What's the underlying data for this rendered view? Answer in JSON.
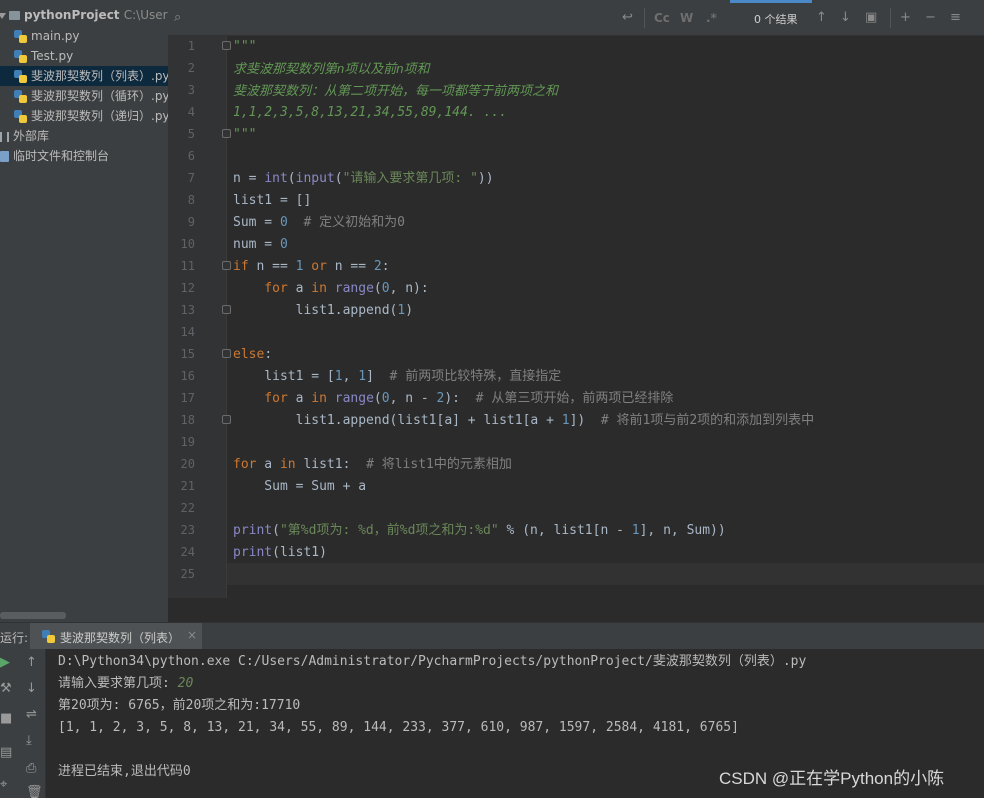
{
  "project_tree": {
    "root_name": "pythonProject",
    "root_path": "C:\\Users\\A",
    "items": [
      {
        "label": "main.py",
        "selected": false
      },
      {
        "label": "Test.py",
        "selected": false
      },
      {
        "label": "斐波那契数列（列表）.py",
        "selected": true
      },
      {
        "label": "斐波那契数列（循环）.py",
        "selected": false
      },
      {
        "label": "斐波那契数列（递归）.py",
        "selected": false
      }
    ],
    "external_libs": "外部库",
    "scratches": "临时文件和控制台"
  },
  "search": {
    "icon": "search-icon",
    "results_text": "0 个结果",
    "match_case_label": "Cc",
    "words_label": "W",
    "regex_label": ".*"
  },
  "editor": {
    "line_numbers": [
      "1",
      "2",
      "3",
      "4",
      "5",
      "6",
      "7",
      "8",
      "9",
      "10",
      "11",
      "12",
      "13",
      "14",
      "15",
      "16",
      "17",
      "18",
      "19",
      "20",
      "21",
      "22",
      "23",
      "24",
      "25"
    ],
    "current_line": "25",
    "code": {
      "l1": "\"\"\"",
      "l2": "求斐波那契数列第n项以及前n项和",
      "l3": "斐波那契数列：从第二项开始，每一项都等于前两项之和",
      "l4": "1,1,2,3,5,8,13,21,34,55,89,144. ...",
      "l5": "\"\"\"",
      "l7_a": "n = ",
      "l7_b": "int",
      "l7_c": "(",
      "l7_d": "input",
      "l7_e": "(",
      "l7_f": "\"请输入要求第几项: \"",
      "l7_g": "))",
      "l8": "list1 = []",
      "l9_a": "Sum = ",
      "l9_b": "0",
      "l9_c": "  # 定义初始和为0",
      "l10_a": "num = ",
      "l10_b": "0",
      "l11_a": "if",
      "l11_b": " n == ",
      "l11_c": "1",
      "l11_d": " or",
      "l11_e": " n == ",
      "l11_f": "2",
      "l11_g": ":",
      "l12_a": "    for",
      "l12_b": " a ",
      "l12_c": "in",
      "l12_d": " ",
      "l12_e": "range",
      "l12_f": "(",
      "l12_g": "0",
      "l12_h": ", n):",
      "l13_a": "        list1.append(",
      "l13_b": "1",
      "l13_c": ")",
      "l15_a": "else",
      "l15_b": ":",
      "l16_a": "    list1 = [",
      "l16_b": "1",
      "l16_c": ", ",
      "l16_d": "1",
      "l16_e": "]",
      "l16_f": "  # 前两项比较特殊，直接指定",
      "l17_a": "    for",
      "l17_b": " a ",
      "l17_c": "in",
      "l17_d": " ",
      "l17_e": "range",
      "l17_f": "(",
      "l17_g": "0",
      "l17_h": ", n - ",
      "l17_i": "2",
      "l17_j": "):",
      "l17_k": "  # 从第三项开始，前两项已经排除",
      "l18_a": "        list1.append(list1[a] + list1[a + ",
      "l18_b": "1",
      "l18_c": "])",
      "l18_d": "  # 将前1项与前2项的和添加到列表中",
      "l20_a": "for",
      "l20_b": " a ",
      "l20_c": "in",
      "l20_d": " list1:",
      "l20_e": "  # 将list1中的元素相加",
      "l21": "    Sum = Sum + a",
      "l23_a": "print",
      "l23_b": "(",
      "l23_c": "\"第%d项为: %d，前%d项之和为:%d\"",
      "l23_d": " % (n, list1[n - ",
      "l23_e": "1",
      "l23_f": "], n, Sum))",
      "l24_a": "print",
      "l24_b": "(list1)"
    }
  },
  "run_panel": {
    "title": "运行:",
    "tab_label": "斐波那契数列（列表）",
    "output": {
      "cmd": "D:\\Python34\\python.exe C:/Users/Administrator/PycharmProjects/pythonProject/斐波那契数列（列表）.py",
      "prompt": "请输入要求第几项: ",
      "input_value": "20",
      "result1": "第20项为: 6765，前20项之和为:17710",
      "result2": "[1, 1, 2, 3, 5, 8, 13, 21, 34, 55, 89, 144, 233, 377, 610, 987, 1597, 2584, 4181, 6765]",
      "exit": "进程已结束,退出代码0"
    }
  },
  "watermark": "CSDN @正在学Python的小陈",
  "colors": {
    "keyword": "#cc7832",
    "number": "#6897bb",
    "string": "#6a8759",
    "comment": "#808080",
    "docstring": "#629755",
    "selection": "#0d293e"
  }
}
